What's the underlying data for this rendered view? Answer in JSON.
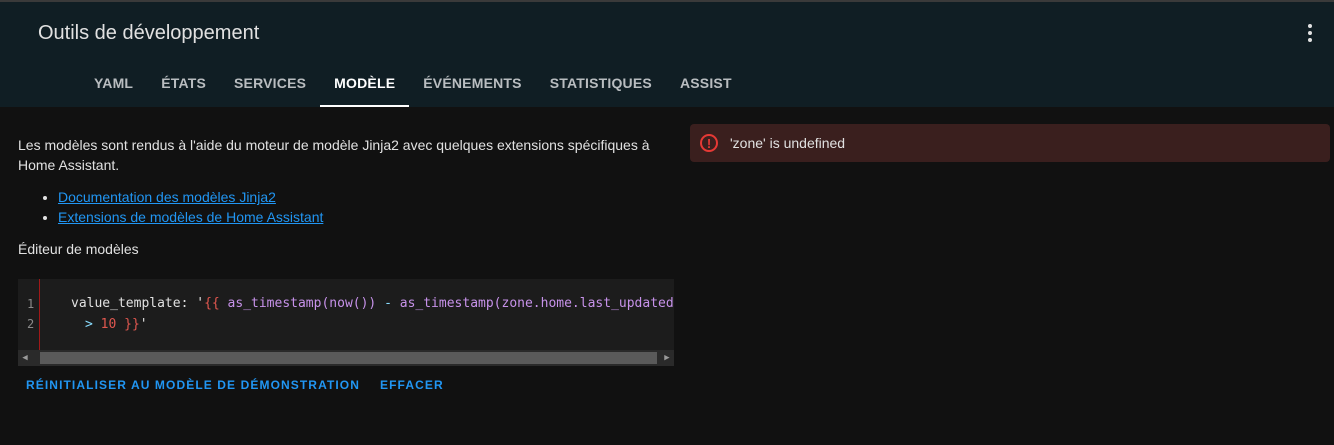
{
  "header": {
    "title": "Outils de développement",
    "tabs": [
      {
        "label": "YAML",
        "active": false
      },
      {
        "label": "ÉTATS",
        "active": false
      },
      {
        "label": "SERVICES",
        "active": false
      },
      {
        "label": "MODÈLE",
        "active": true
      },
      {
        "label": "ÉVÉNEMENTS",
        "active": false
      },
      {
        "label": "STATISTIQUES",
        "active": false
      },
      {
        "label": "ASSIST",
        "active": false
      }
    ]
  },
  "main": {
    "intro": "Les modèles sont rendus à l'aide du moteur de modèle Jinja2 avec quelques extensions spécifiques à Home Assistant.",
    "links": [
      "Documentation des modèles Jinja2",
      "Extensions de modèles de Home Assistant"
    ],
    "editor_label": "Éditeur de modèles",
    "editor": {
      "line_numbers": [
        "1",
        "2"
      ],
      "line1": {
        "key": "value_template: '",
        "open": "{{",
        "fn1": " as_timestamp(now()) ",
        "op": "-",
        "fn2": " as_timestamp(zone.home.last_updated)"
      },
      "line2": {
        "op": "> ",
        "num": "10",
        "close": " }}",
        "end": "'"
      }
    },
    "actions": {
      "reset_label": "RÉINITIALISER AU MODÈLE DE DÉMONSTRATION",
      "clear_label": "EFFACER"
    }
  },
  "result": {
    "error_text": "'zone' is undefined",
    "error_icon": "alert-circle-icon"
  },
  "colors": {
    "header_bg": "#101e24",
    "page_bg": "#111111",
    "accent": "#2196f3",
    "error": "#e53935"
  }
}
